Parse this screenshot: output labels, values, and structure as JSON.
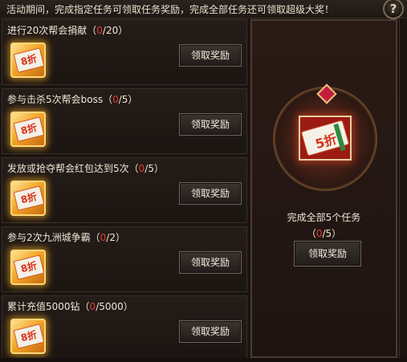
{
  "banner": {
    "text": "活动期间，完成指定任务可领取任务奖励，完成全部任务还可领取超级大奖！",
    "help_label": "?"
  },
  "tasks": [
    {
      "title": "进行20次帮会捐献（",
      "current": "0",
      "total": "/20）",
      "reward_label": "8折",
      "button_label": "领取奖励"
    },
    {
      "title": "参与击杀5次帮会boss（",
      "current": "0",
      "total": "/5）",
      "reward_label": "8折",
      "button_label": "领取奖励"
    },
    {
      "title": "发放或抢夺帮会红包达到5次（",
      "current": "0",
      "total": "/5）",
      "reward_label": "8折",
      "button_label": "领取奖励"
    },
    {
      "title": "参与2次九洲城争霸（",
      "current": "0",
      "total": "/2）",
      "reward_label": "8折",
      "button_label": "领取奖励"
    },
    {
      "title": "累计充值5000钻（",
      "current": "0",
      "total": "/5000）",
      "reward_label": "8折",
      "button_label": "领取奖励"
    }
  ],
  "grand_prize": {
    "reward_label": "5折",
    "title": "完成全部5个任务",
    "progress_open": "（",
    "current": "0",
    "total": "/5）",
    "button_label": "领取奖励"
  }
}
